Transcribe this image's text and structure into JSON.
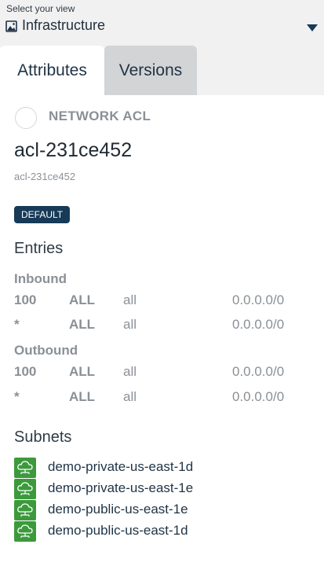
{
  "view_selector": {
    "caption": "Select your view",
    "value": "Infrastructure",
    "icon": "image-icon"
  },
  "tabs": [
    {
      "label": "Attributes",
      "active": true
    },
    {
      "label": "Versions",
      "active": false
    }
  ],
  "resource": {
    "type_label": "NETWORK ACL",
    "name": "acl-231ce452",
    "id": "acl-231ce452",
    "badge": "DEFAULT"
  },
  "entries": {
    "heading": "Entries",
    "inbound_label": "Inbound",
    "inbound": [
      {
        "rule": "100",
        "protocol": "ALL",
        "ports": "all",
        "cidr": "0.0.0.0/0"
      },
      {
        "rule": "*",
        "protocol": "ALL",
        "ports": "all",
        "cidr": "0.0.0.0/0"
      }
    ],
    "outbound_label": "Outbound",
    "outbound": [
      {
        "rule": "100",
        "protocol": "ALL",
        "ports": "all",
        "cidr": "0.0.0.0/0"
      },
      {
        "rule": "*",
        "protocol": "ALL",
        "ports": "all",
        "cidr": "0.0.0.0/0"
      }
    ]
  },
  "subnets": {
    "heading": "Subnets",
    "items": [
      "demo-private-us-east-1d",
      "demo-private-us-east-1e",
      "demo-public-us-east-1e",
      "demo-public-us-east-1d"
    ]
  },
  "colors": {
    "badge_bg": "#163a57",
    "subnet_icon": "#3c9a3c",
    "inactive_tab": "#d3d4d6"
  }
}
